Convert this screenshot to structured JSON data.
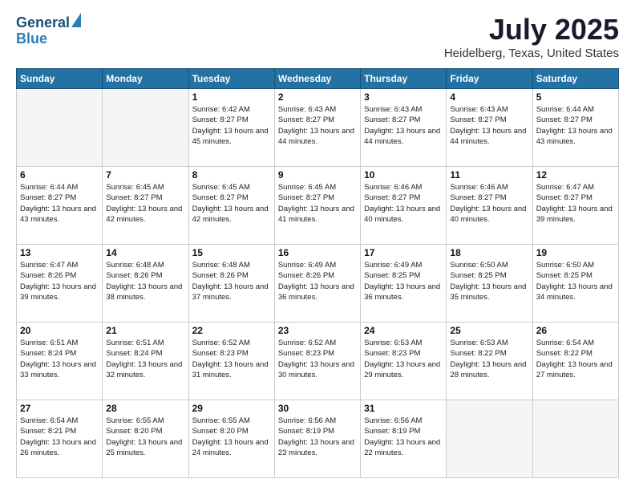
{
  "header": {
    "logo_line1": "General",
    "logo_line2": "Blue",
    "title": "July 2025",
    "subtitle": "Heidelberg, Texas, United States"
  },
  "days_of_week": [
    "Sunday",
    "Monday",
    "Tuesday",
    "Wednesday",
    "Thursday",
    "Friday",
    "Saturday"
  ],
  "weeks": [
    [
      {
        "day": "",
        "empty": true
      },
      {
        "day": "",
        "empty": true
      },
      {
        "day": "1",
        "rise": "6:42 AM",
        "set": "8:27 PM",
        "daylight": "13 hours and 45 minutes."
      },
      {
        "day": "2",
        "rise": "6:43 AM",
        "set": "8:27 PM",
        "daylight": "13 hours and 44 minutes."
      },
      {
        "day": "3",
        "rise": "6:43 AM",
        "set": "8:27 PM",
        "daylight": "13 hours and 44 minutes."
      },
      {
        "day": "4",
        "rise": "6:43 AM",
        "set": "8:27 PM",
        "daylight": "13 hours and 44 minutes."
      },
      {
        "day": "5",
        "rise": "6:44 AM",
        "set": "8:27 PM",
        "daylight": "13 hours and 43 minutes."
      }
    ],
    [
      {
        "day": "6",
        "rise": "6:44 AM",
        "set": "8:27 PM",
        "daylight": "13 hours and 43 minutes."
      },
      {
        "day": "7",
        "rise": "6:45 AM",
        "set": "8:27 PM",
        "daylight": "13 hours and 42 minutes."
      },
      {
        "day": "8",
        "rise": "6:45 AM",
        "set": "8:27 PM",
        "daylight": "13 hours and 42 minutes."
      },
      {
        "day": "9",
        "rise": "6:45 AM",
        "set": "8:27 PM",
        "daylight": "13 hours and 41 minutes."
      },
      {
        "day": "10",
        "rise": "6:46 AM",
        "set": "8:27 PM",
        "daylight": "13 hours and 40 minutes."
      },
      {
        "day": "11",
        "rise": "6:46 AM",
        "set": "8:27 PM",
        "daylight": "13 hours and 40 minutes."
      },
      {
        "day": "12",
        "rise": "6:47 AM",
        "set": "8:27 PM",
        "daylight": "13 hours and 39 minutes."
      }
    ],
    [
      {
        "day": "13",
        "rise": "6:47 AM",
        "set": "8:26 PM",
        "daylight": "13 hours and 39 minutes."
      },
      {
        "day": "14",
        "rise": "6:48 AM",
        "set": "8:26 PM",
        "daylight": "13 hours and 38 minutes."
      },
      {
        "day": "15",
        "rise": "6:48 AM",
        "set": "8:26 PM",
        "daylight": "13 hours and 37 minutes."
      },
      {
        "day": "16",
        "rise": "6:49 AM",
        "set": "8:26 PM",
        "daylight": "13 hours and 36 minutes."
      },
      {
        "day": "17",
        "rise": "6:49 AM",
        "set": "8:25 PM",
        "daylight": "13 hours and 36 minutes."
      },
      {
        "day": "18",
        "rise": "6:50 AM",
        "set": "8:25 PM",
        "daylight": "13 hours and 35 minutes."
      },
      {
        "day": "19",
        "rise": "6:50 AM",
        "set": "8:25 PM",
        "daylight": "13 hours and 34 minutes."
      }
    ],
    [
      {
        "day": "20",
        "rise": "6:51 AM",
        "set": "8:24 PM",
        "daylight": "13 hours and 33 minutes."
      },
      {
        "day": "21",
        "rise": "6:51 AM",
        "set": "8:24 PM",
        "daylight": "13 hours and 32 minutes."
      },
      {
        "day": "22",
        "rise": "6:52 AM",
        "set": "8:23 PM",
        "daylight": "13 hours and 31 minutes."
      },
      {
        "day": "23",
        "rise": "6:52 AM",
        "set": "8:23 PM",
        "daylight": "13 hours and 30 minutes."
      },
      {
        "day": "24",
        "rise": "6:53 AM",
        "set": "8:23 PM",
        "daylight": "13 hours and 29 minutes."
      },
      {
        "day": "25",
        "rise": "6:53 AM",
        "set": "8:22 PM",
        "daylight": "13 hours and 28 minutes."
      },
      {
        "day": "26",
        "rise": "6:54 AM",
        "set": "8:22 PM",
        "daylight": "13 hours and 27 minutes."
      }
    ],
    [
      {
        "day": "27",
        "rise": "6:54 AM",
        "set": "8:21 PM",
        "daylight": "13 hours and 26 minutes."
      },
      {
        "day": "28",
        "rise": "6:55 AM",
        "set": "8:20 PM",
        "daylight": "13 hours and 25 minutes."
      },
      {
        "day": "29",
        "rise": "6:55 AM",
        "set": "8:20 PM",
        "daylight": "13 hours and 24 minutes."
      },
      {
        "day": "30",
        "rise": "6:56 AM",
        "set": "8:19 PM",
        "daylight": "13 hours and 23 minutes."
      },
      {
        "day": "31",
        "rise": "6:56 AM",
        "set": "8:19 PM",
        "daylight": "13 hours and 22 minutes."
      },
      {
        "day": "",
        "empty": true
      },
      {
        "day": "",
        "empty": true
      }
    ]
  ]
}
